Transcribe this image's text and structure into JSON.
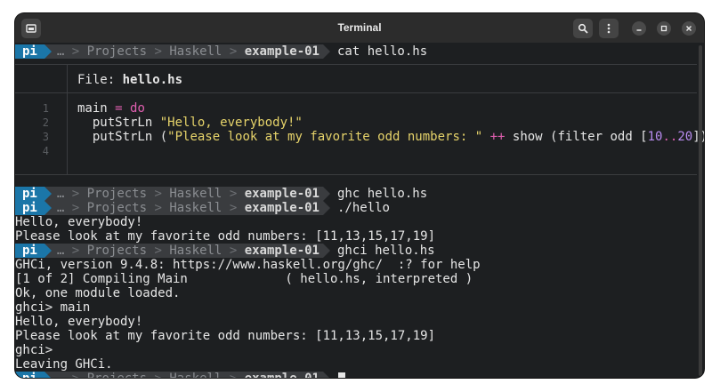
{
  "window": {
    "title": "Terminal"
  },
  "prompt": {
    "host": "pi",
    "path": [
      "…",
      "Projects",
      "Haskell",
      "example-01"
    ]
  },
  "bat": {
    "file_label": "File:",
    "file_name": "hello.hs",
    "line_numbers": [
      "1",
      "2",
      "3",
      "4"
    ],
    "code": {
      "l1_a": "main ",
      "l1_eq": "=",
      "l1_do": " do",
      "l2_fn": "  putStrLn ",
      "l2_str": "\"Hello, everybody!\"",
      "l3_fn": "  putStrLn (",
      "l3_str": "\"Please look at my favorite odd numbers: \"",
      "l3_op": " ++ ",
      "l3_show": "show (filter odd [",
      "l3_n1": "10",
      "l3_dots": "..",
      "l3_n2": "20",
      "l3_end": "]))"
    }
  },
  "commands": {
    "c1": "cat hello.hs",
    "c2": "ghc hello.hs",
    "c3": "./hello",
    "c4": "ghci hello.hs"
  },
  "output": {
    "o1": "Hello, everybody!",
    "o2": "Please look at my favorite odd numbers: [11,13,15,17,19]",
    "o3": "GHCi, version 9.4.8: https://www.haskell.org/ghc/  :? for help",
    "o4": "[1 of 2] Compiling Main             ( hello.hs, interpreted )",
    "o5": "Ok, one module loaded.",
    "o6": "ghci> main",
    "o7": "Hello, everybody!",
    "o8": "Please look at my favorite odd numbers: [11,13,15,17,19]",
    "o9": "ghci>",
    "o10": "Leaving GHCi."
  }
}
